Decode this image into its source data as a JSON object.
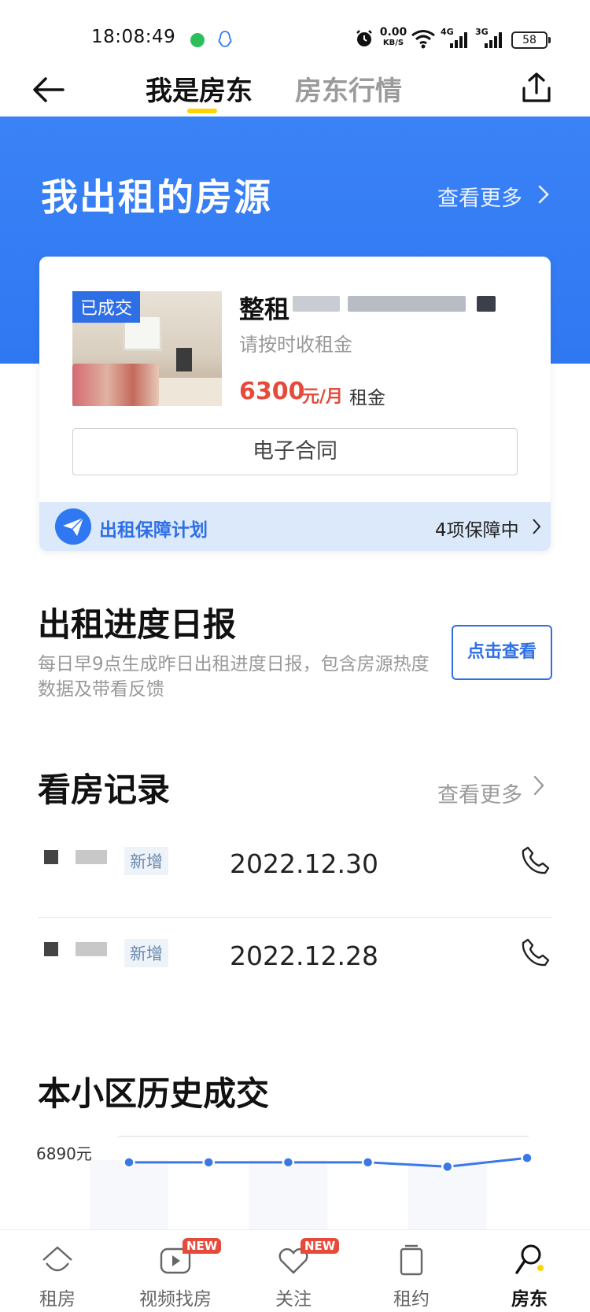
{
  "status_bar": {
    "time": "18:08:49",
    "net_speed_value": "0.00",
    "net_speed_unit": "KB/S",
    "signal1_label": "4G",
    "signal2_label": "3G",
    "battery": "58"
  },
  "nav": {
    "tabs": [
      {
        "label": "我是房东",
        "active": true
      },
      {
        "label": "房东行情",
        "active": false
      }
    ],
    "accent_color": "#ffd400"
  },
  "listings_section": {
    "title": "我出租的房源",
    "more_label": "查看更多",
    "band_color": "#2f78f2"
  },
  "listing_card": {
    "badge": "已成交",
    "title": "整租",
    "subtitle": "请按时收租金",
    "price": "6300",
    "price_unit": "元/月",
    "price_label": "租金",
    "contract_button": "电子合同",
    "guarantee_label": "出租保障计划",
    "guarantee_status": "4项保障中",
    "price_color": "#e64a3b"
  },
  "daily_report": {
    "title": "出租进度日报",
    "description": "每日早9点生成昨日出租进度日报，包含房源热度数据及带看反馈",
    "button": "点击查看"
  },
  "viewing_records": {
    "title": "看房记录",
    "more_label": "查看更多",
    "rows": [
      {
        "tag": "新增",
        "date": "2022.12.30"
      },
      {
        "tag": "新增",
        "date": "2022.12.28"
      }
    ]
  },
  "history": {
    "title": "本小区历史成交",
    "y_max_label": "6890元"
  },
  "chart_data": {
    "type": "line",
    "series": [
      {
        "values": [
          6300,
          6300,
          6300,
          6300,
          6200,
          6400
        ]
      }
    ],
    "ylim": [
      0,
      6890
    ],
    "grid": true,
    "color": "#3b78e7"
  },
  "bottom_bar": {
    "items": [
      {
        "label": "租房",
        "icon": "house-icon",
        "new": false,
        "active": false
      },
      {
        "label": "视频找房",
        "icon": "video-play-icon",
        "new": true,
        "active": false
      },
      {
        "label": "关注",
        "icon": "heart-icon",
        "new": true,
        "active": false
      },
      {
        "label": "租约",
        "icon": "document-icon",
        "new": false,
        "active": false
      },
      {
        "label": "房东",
        "icon": "landlord-key-icon",
        "new": false,
        "active": true
      }
    ],
    "new_badge": "NEW"
  }
}
